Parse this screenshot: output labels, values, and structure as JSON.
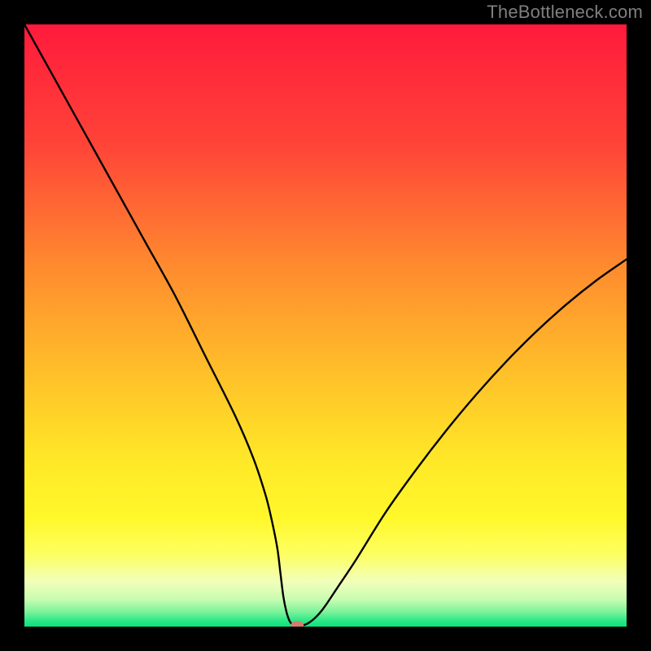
{
  "watermark": "TheBottleneck.com",
  "chart_data": {
    "type": "line",
    "title": "",
    "xlabel": "",
    "ylabel": "",
    "xlim": [
      0,
      100
    ],
    "ylim": [
      0,
      100
    ],
    "grid": false,
    "series": [
      {
        "name": "bottleneck-curve",
        "x": [
          0,
          5,
          10,
          15,
          20,
          25,
          30,
          35,
          38,
          40,
          41,
          42,
          42.5,
          43,
          43.5,
          44,
          44.5,
          45,
          45.5,
          46,
          47,
          48,
          49,
          50,
          52,
          55,
          60,
          65,
          70,
          75,
          80,
          85,
          90,
          95,
          100
        ],
        "y": [
          100,
          91,
          82,
          73,
          64,
          55,
          45,
          35,
          28,
          22,
          18,
          13,
          9,
          5,
          2.5,
          1,
          0.3,
          0,
          0,
          0.1,
          0.5,
          1.2,
          2.2,
          3.5,
          6.5,
          11,
          19,
          26,
          32.5,
          38.5,
          44,
          49,
          53.5,
          57.5,
          61
        ]
      }
    ],
    "marker": {
      "x": 45.3,
      "y": 0.2,
      "color": "#d97a6c"
    },
    "backgroundGradient": {
      "stops": [
        {
          "offset": 0.0,
          "color": "#ff1a3c"
        },
        {
          "offset": 0.2,
          "color": "#ff4438"
        },
        {
          "offset": 0.4,
          "color": "#ff8a2f"
        },
        {
          "offset": 0.58,
          "color": "#ffc029"
        },
        {
          "offset": 0.72,
          "color": "#ffe728"
        },
        {
          "offset": 0.82,
          "color": "#fff82a"
        },
        {
          "offset": 0.88,
          "color": "#fdff62"
        },
        {
          "offset": 0.925,
          "color": "#f2ffba"
        },
        {
          "offset": 0.955,
          "color": "#c8fcb2"
        },
        {
          "offset": 0.975,
          "color": "#7ef39a"
        },
        {
          "offset": 0.99,
          "color": "#2ce887"
        },
        {
          "offset": 1.0,
          "color": "#0be37e"
        }
      ]
    }
  }
}
